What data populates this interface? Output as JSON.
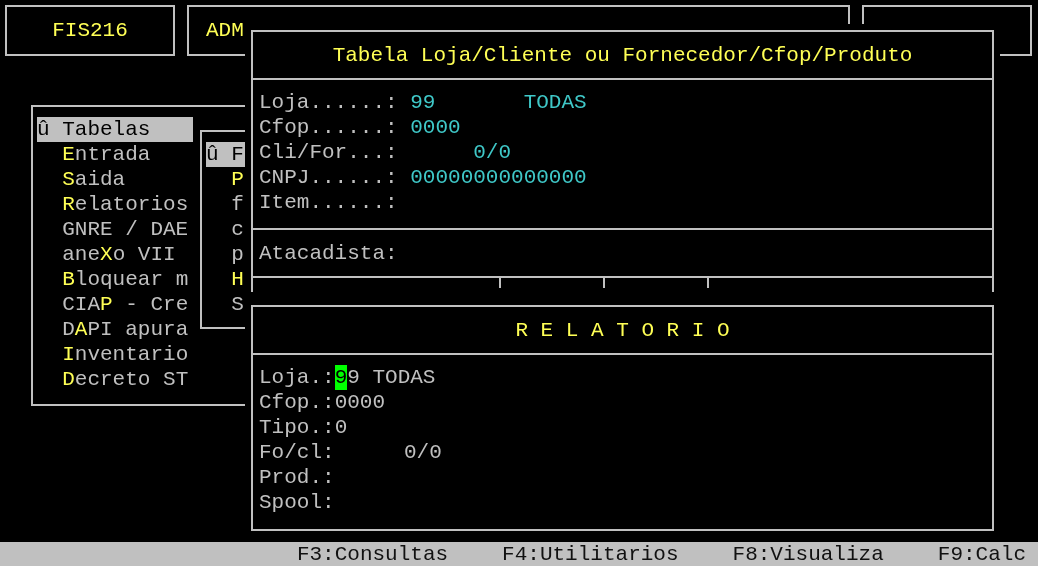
{
  "header": {
    "program": "FIS216",
    "user": "ADM"
  },
  "menu": {
    "items": [
      {
        "marker": "û",
        "before": "Tabelas",
        "selected": true
      },
      {
        "key": "E",
        "after": "ntrada",
        "selected": false
      },
      {
        "key": "S",
        "after": "aida",
        "selected": false
      },
      {
        "key": "R",
        "after": "elatorios",
        "selected": false
      },
      {
        "before": "GNRE / DAE",
        "selected": false
      },
      {
        "before": "ane",
        "key": "X",
        "after": "o VII",
        "selected": false
      },
      {
        "key": "B",
        "after": "loquear m",
        "selected": false
      },
      {
        "before": "CIA",
        "key": "P",
        "after": " - Cre",
        "selected": false
      },
      {
        "before": "D",
        "key": "A",
        "after": "PI apura",
        "selected": false
      },
      {
        "key": "I",
        "after": "nventario",
        "selected": false
      },
      {
        "key": "D",
        "after": "ecreto ST",
        "selected": false
      }
    ]
  },
  "submenu": {
    "items": [
      {
        "marker": "û",
        "before": "F",
        "selected": true
      },
      {
        "key": "P",
        "selected": false
      },
      {
        "before": "f",
        "selected": false
      },
      {
        "before": "c",
        "selected": false
      },
      {
        "before": "p",
        "selected": false
      },
      {
        "key": "H",
        "selected": false
      },
      {
        "before": "S",
        "selected": false
      }
    ]
  },
  "table_window": {
    "title": "Tabela Loja/Cliente ou Fornecedor/Cfop/Produto",
    "fields": [
      {
        "kind": "left",
        "label": "Loja......:",
        "value": "99",
        "note": "TODAS"
      },
      {
        "kind": "left",
        "label": "Cfop......:",
        "value": "0000"
      },
      {
        "kind": "right",
        "label": "Cli/For...:",
        "value": "0/0"
      },
      {
        "kind": "left",
        "label": "CNPJ......:",
        "value": "00000000000000"
      },
      {
        "label": "Item......:"
      }
    ],
    "footer_label": "Atacadista:"
  },
  "report_window": {
    "title": "R E L A T O R I O",
    "fields": [
      {
        "kind": "left",
        "label": "Loja.:",
        "cursor": "9",
        "value": "9 TODAS"
      },
      {
        "kind": "left",
        "label": "Cfop.:",
        "value": "0000"
      },
      {
        "kind": "left",
        "label": "Tipo.:",
        "value": "0"
      },
      {
        "kind": "right",
        "label": "Fo/cl:",
        "value": "0/0"
      },
      {
        "label": "Prod.:"
      },
      {
        "label": "Spool:"
      }
    ]
  },
  "status_bar": [
    "F3:Consultas",
    "F4:Utilitarios",
    "F8:Visualiza",
    "F9:Calc"
  ]
}
